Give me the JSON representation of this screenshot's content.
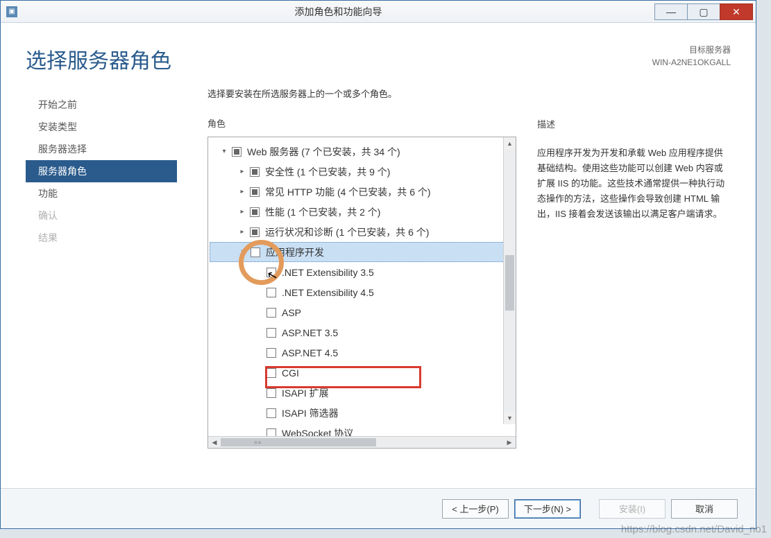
{
  "titlebar": {
    "title": "添加角色和功能向导"
  },
  "header": {
    "page_title": "选择服务器角色",
    "target_label": "目标服务器",
    "target_name": "WIN-A2NE1OKGALL"
  },
  "sidebar": {
    "items": [
      {
        "label": "开始之前",
        "state": "normal"
      },
      {
        "label": "安装类型",
        "state": "normal"
      },
      {
        "label": "服务器选择",
        "state": "normal"
      },
      {
        "label": "服务器角色",
        "state": "active"
      },
      {
        "label": "功能",
        "state": "normal"
      },
      {
        "label": "确认",
        "state": "disabled"
      },
      {
        "label": "结果",
        "state": "disabled"
      }
    ]
  },
  "main": {
    "instruction": "选择要安装在所选服务器上的一个或多个角色。",
    "roles_label": "角色",
    "desc_label": "描述",
    "description": "应用程序开发为开发和承载 Web 应用程序提供基础结构。使用这些功能可以创建 Web 内容或扩展 IIS 的功能。这些技术通常提供一种执行动态操作的方法，这些操作会导致创建 HTML 输出，IIS 接着会发送该输出以满足客户端请求。"
  },
  "tree": [
    {
      "indent": 0,
      "expander": "down",
      "check": "partial",
      "label": "Web 服务器 (7 个已安装，共 34 个)"
    },
    {
      "indent": 1,
      "expander": "right",
      "check": "partial",
      "label": "安全性 (1 个已安装，共 9 个)"
    },
    {
      "indent": 1,
      "expander": "right",
      "check": "partial",
      "label": "常见 HTTP 功能 (4 个已安装，共 6 个)"
    },
    {
      "indent": 1,
      "expander": "right",
      "check": "partial",
      "label": "性能 (1 个已安装，共 2 个)"
    },
    {
      "indent": 1,
      "expander": "right",
      "check": "partial",
      "label": "运行状况和诊断 (1 个已安装，共 6 个)"
    },
    {
      "indent": 1,
      "expander": "down",
      "check": "empty",
      "label": "应用程序开发",
      "selected": true
    },
    {
      "indent": 2,
      "expander": "",
      "check": "empty",
      "label": ".NET Extensibility 3.5"
    },
    {
      "indent": 2,
      "expander": "",
      "check": "empty",
      "label": ".NET Extensibility 4.5"
    },
    {
      "indent": 2,
      "expander": "",
      "check": "empty",
      "label": "ASP"
    },
    {
      "indent": 2,
      "expander": "",
      "check": "empty",
      "label": "ASP.NET 3.5"
    },
    {
      "indent": 2,
      "expander": "",
      "check": "empty",
      "label": "ASP.NET 4.5"
    },
    {
      "indent": 2,
      "expander": "",
      "check": "empty",
      "label": "CGI"
    },
    {
      "indent": 2,
      "expander": "",
      "check": "empty",
      "label": "ISAPI 扩展"
    },
    {
      "indent": 2,
      "expander": "",
      "check": "empty",
      "label": "ISAPI 筛选器"
    },
    {
      "indent": 2,
      "expander": "",
      "check": "empty",
      "label": "WebSocket 协议"
    }
  ],
  "footer": {
    "prev": "< 上一步(P)",
    "next": "下一步(N) >",
    "install": "安装(I)",
    "cancel": "取消"
  },
  "watermark": "https://blog.csdn.net/David_no1"
}
